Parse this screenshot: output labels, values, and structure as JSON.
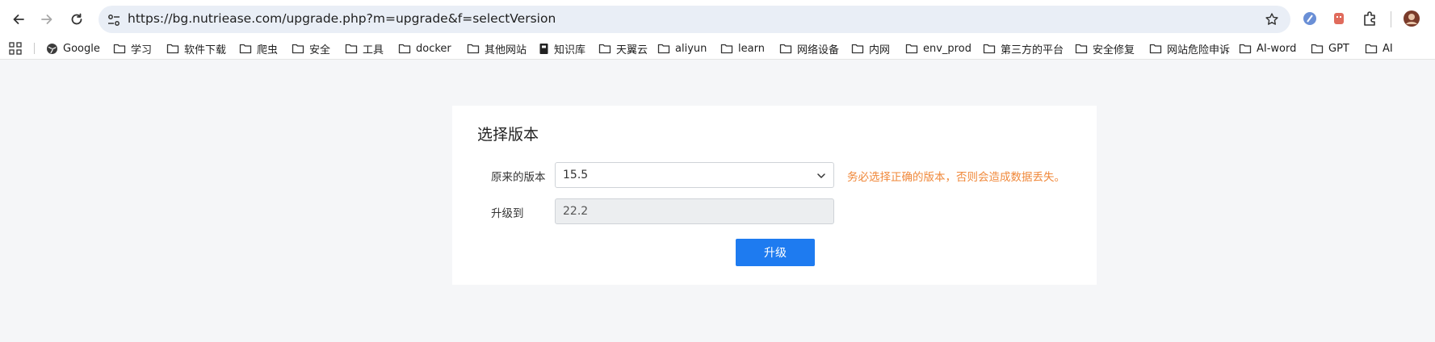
{
  "browser": {
    "url": "https://bg.nutriease.com/upgrade.php?m=upgrade&f=selectVersion",
    "bookmarks": [
      {
        "label": "Google",
        "icon": "google-globe-icon"
      },
      {
        "label": "学习",
        "icon": "folder-icon"
      },
      {
        "label": "软件下载",
        "icon": "folder-icon"
      },
      {
        "label": "爬虫",
        "icon": "folder-icon"
      },
      {
        "label": "安全",
        "icon": "folder-icon"
      },
      {
        "label": "工具",
        "icon": "folder-icon"
      },
      {
        "label": "docker",
        "icon": "folder-icon"
      },
      {
        "label": "其他网站",
        "icon": "folder-icon"
      },
      {
        "label": "知识库",
        "icon": "book-icon"
      },
      {
        "label": "天翼云",
        "icon": "folder-icon"
      },
      {
        "label": "aliyun",
        "icon": "folder-icon"
      },
      {
        "label": "learn",
        "icon": "folder-icon"
      },
      {
        "label": "网络设备",
        "icon": "folder-icon"
      },
      {
        "label": "内网",
        "icon": "folder-icon"
      },
      {
        "label": "env_prod",
        "icon": "folder-icon"
      },
      {
        "label": "第三方的平台",
        "icon": "folder-icon"
      },
      {
        "label": "安全修复",
        "icon": "folder-icon"
      },
      {
        "label": "网站危险申诉",
        "icon": "folder-icon"
      },
      {
        "label": "AI-word",
        "icon": "folder-icon"
      },
      {
        "label": "GPT",
        "icon": "folder-icon"
      },
      {
        "label": "AI",
        "icon": "folder-icon"
      }
    ]
  },
  "page": {
    "title": "选择版本",
    "original_version_label": "原来的版本",
    "original_version_value": "15.5",
    "warning": "务必选择正确的版本，否则会造成数据丢失。",
    "upgrade_to_label": "升级到",
    "upgrade_to_value": "22.2",
    "submit_label": "升级"
  },
  "colors": {
    "primary_button": "#1e7bf0",
    "warning_text": "#f0883a",
    "page_background": "#f5f6f8"
  }
}
